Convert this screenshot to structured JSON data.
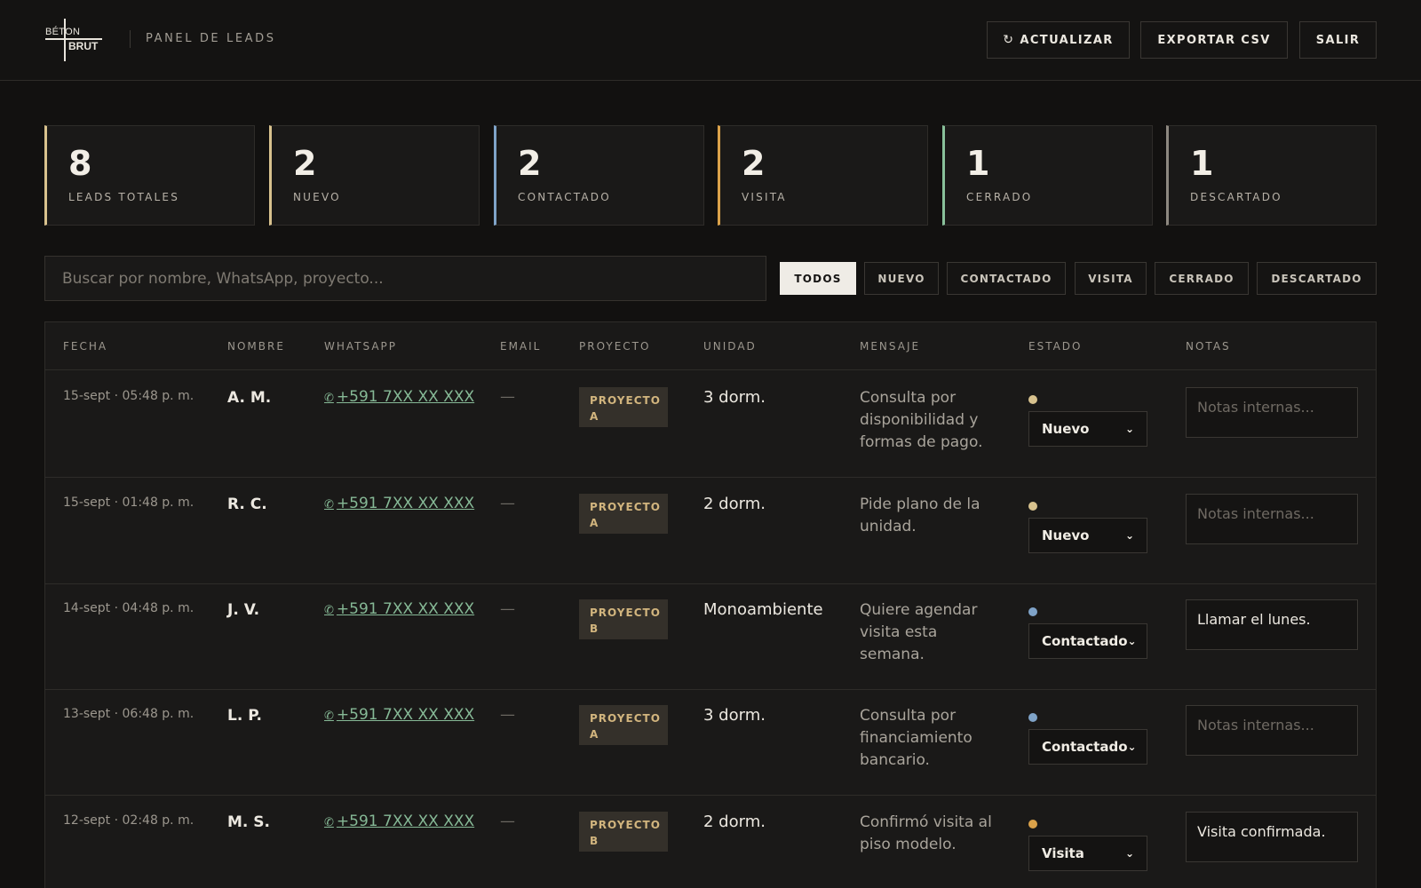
{
  "brand": {
    "logo_top": "BÉTON",
    "logo_bottom": "BRUT",
    "panel_title": "PANEL DE LEADS"
  },
  "actions": {
    "refresh_icon": "↻",
    "refresh": "ACTUALIZAR",
    "export": "EXPORTAR CSV",
    "logout": "SALIR"
  },
  "stats": [
    {
      "value": "8",
      "label": "LEADS TOTALES",
      "color": "#d8c28e"
    },
    {
      "value": "2",
      "label": "NUEVO",
      "color": "#d8c28e"
    },
    {
      "value": "2",
      "label": "CONTACTADO",
      "color": "#7fa3c8"
    },
    {
      "value": "2",
      "label": "VISITA",
      "color": "#dba24a"
    },
    {
      "value": "1",
      "label": "CERRADO",
      "color": "#88c09a"
    },
    {
      "value": "1",
      "label": "DESCARTADO",
      "color": "#8d8880"
    }
  ],
  "search": {
    "placeholder": "Buscar por nombre, WhatsApp, proyecto..."
  },
  "filters": [
    "TODOS",
    "NUEVO",
    "CONTACTADO",
    "VISITA",
    "CERRADO",
    "DESCARTADO"
  ],
  "table": {
    "headers": [
      "FECHA",
      "NOMBRE",
      "WHATSAPP",
      "EMAIL",
      "PROYECTO",
      "UNIDAD",
      "MENSAJE",
      "ESTADO",
      "NOTAS"
    ],
    "notes_placeholder": "Notas internas...",
    "rows": [
      {
        "date": "15-sept · 05:48 p. m.",
        "name": "A. M.",
        "whatsapp": "+591 7XX XX XXX",
        "email": "—",
        "project_l1": "PROYECTO",
        "project_l2": "A",
        "unit": "3 dorm.",
        "message": "Consulta por disponibilidad y formas de pago.",
        "status": "Nuevo",
        "status_color": "#d8c28e",
        "notes": ""
      },
      {
        "date": "15-sept · 01:48 p. m.",
        "name": "R. C.",
        "whatsapp": "+591 7XX XX XXX",
        "email": "—",
        "project_l1": "PROYECTO",
        "project_l2": "A",
        "unit": "2 dorm.",
        "message": "Pide plano de la unidad.",
        "status": "Nuevo",
        "status_color": "#d8c28e",
        "notes": ""
      },
      {
        "date": "14-sept · 04:48 p. m.",
        "name": "J. V.",
        "whatsapp": "+591 7XX XX XXX",
        "email": "—",
        "project_l1": "PROYECTO",
        "project_l2": "B",
        "unit": "Monoambiente",
        "message": "Quiere agendar visita esta semana.",
        "status": "Contactado",
        "status_color": "#7fa3c8",
        "notes": "Llamar el lunes."
      },
      {
        "date": "13-sept · 06:48 p. m.",
        "name": "L. P.",
        "whatsapp": "+591 7XX XX XXX",
        "email": "—",
        "project_l1": "PROYECTO",
        "project_l2": "A",
        "unit": "3 dorm.",
        "message": "Consulta por financiamiento bancario.",
        "status": "Contactado",
        "status_color": "#7fa3c8",
        "notes": ""
      },
      {
        "date": "12-sept · 02:48 p. m.",
        "name": "M. S.",
        "whatsapp": "+591 7XX XX XXX",
        "email": "—",
        "project_l1": "PROYECTO",
        "project_l2": "B",
        "unit": "2 dorm.",
        "message": "Confirmó visita al piso modelo.",
        "status": "Visita",
        "status_color": "#dba24a",
        "notes": "Visita confirmada."
      }
    ]
  },
  "icons": {
    "whatsapp": "✆",
    "chevron": "⌄"
  }
}
